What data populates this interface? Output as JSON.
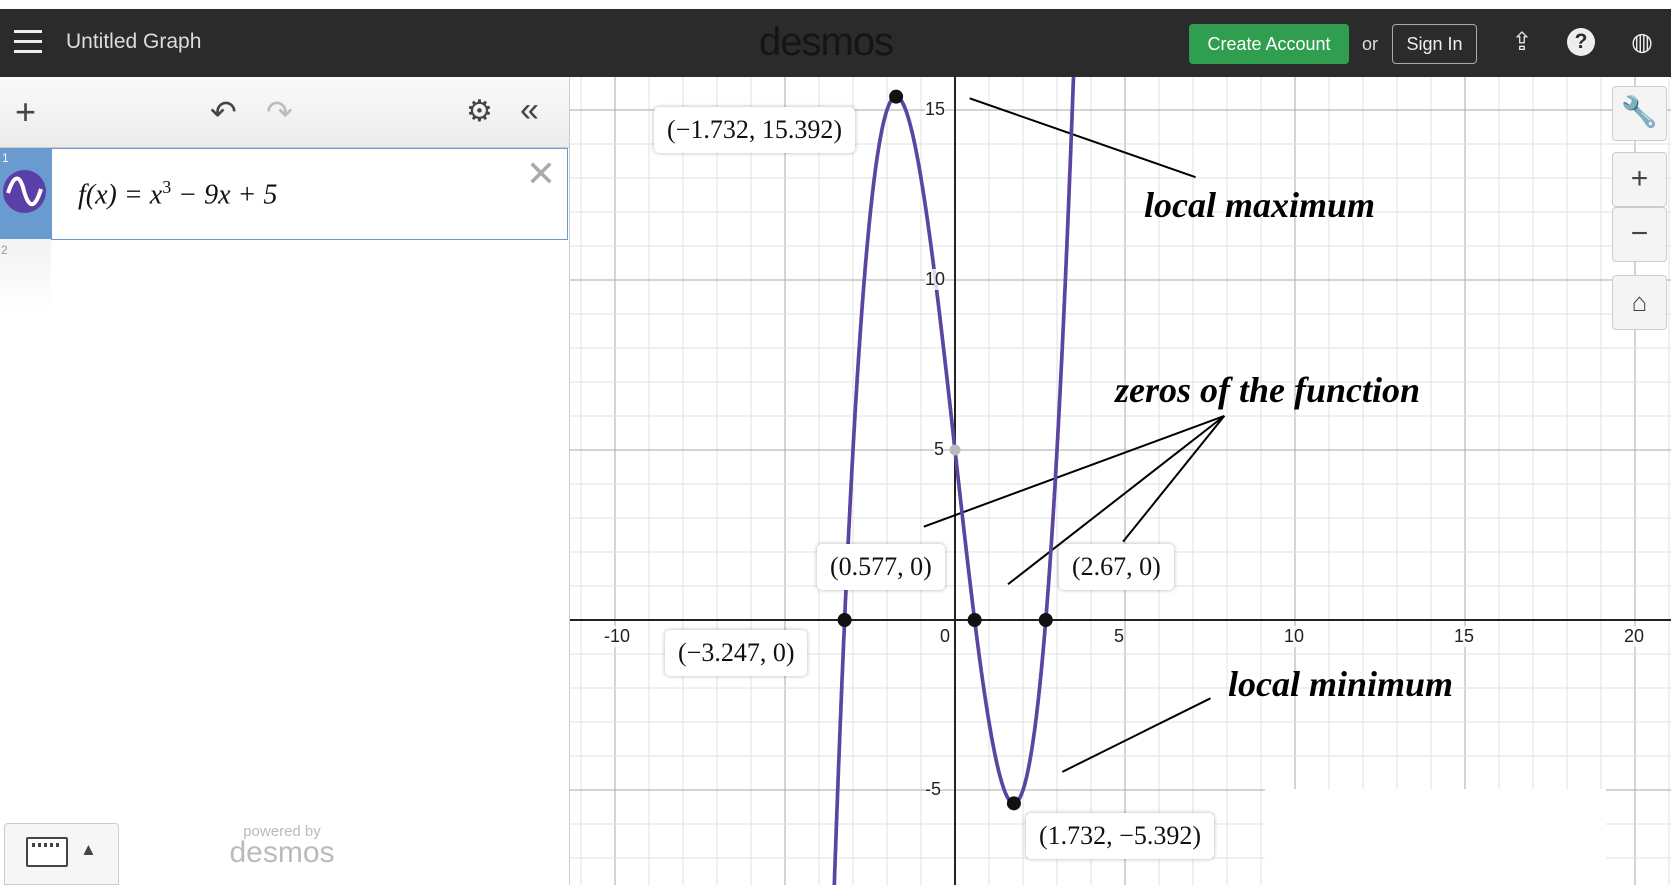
{
  "header": {
    "title": "Untitled Graph",
    "logo": "desmos",
    "create_account": "Create Account",
    "or": "or",
    "sign_in": "Sign In",
    "icons": [
      "share-icon",
      "help-icon",
      "language-globe-icon"
    ]
  },
  "panel": {
    "expressions": [
      {
        "number": "1",
        "fx": "f(x) = x",
        "exp": "3",
        "rest": " − 9x + 5",
        "color": "#5a3fa8"
      },
      {
        "number": "2"
      }
    ],
    "powered_by": "powered by",
    "powered_logo": "desmos"
  },
  "graph": {
    "curve_color": "#5b45a0",
    "x_ticks": [
      {
        "v": -10,
        "t": "-10"
      },
      {
        "v": -5,
        "t": "-"
      },
      {
        "v": 0,
        "t": "0"
      },
      {
        "v": 5,
        "t": "5"
      },
      {
        "v": 10,
        "t": "10"
      },
      {
        "v": 15,
        "t": "15"
      },
      {
        "v": 20,
        "t": "20"
      }
    ],
    "y_ticks": [
      {
        "v": 15,
        "t": "15"
      },
      {
        "v": 10,
        "t": "10"
      },
      {
        "v": 5,
        "t": "5"
      },
      {
        "v": -5,
        "t": "-5"
      }
    ],
    "points": [
      {
        "x": -1.732,
        "y": 15.392,
        "label": "(−1.732, 15.392)"
      },
      {
        "x": 1.732,
        "y": -5.392,
        "label": "(1.732, −5.392)"
      },
      {
        "x": -3.247,
        "y": 0,
        "label": "(−3.247, 0)"
      },
      {
        "x": 0.577,
        "y": 0,
        "label": "(0.577, 0)"
      },
      {
        "x": 2.67,
        "y": 0,
        "label": "(2.67, 0)"
      }
    ],
    "intercept": {
      "x": 0,
      "y": 5
    },
    "annotations": {
      "max": "local maximum",
      "zeros": "zeros of the function",
      "min": "local minimum"
    }
  }
}
